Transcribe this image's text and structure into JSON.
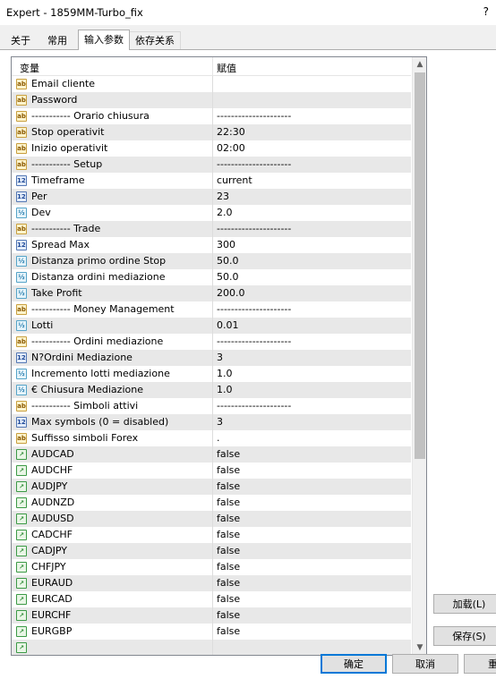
{
  "window": {
    "title": "Expert - 1859MM-Turbo_fix",
    "help": "?"
  },
  "tabs": [
    {
      "label": "关于"
    },
    {
      "label": "常用"
    },
    {
      "label": "输入参数"
    },
    {
      "label": "依存关系"
    }
  ],
  "columns": {
    "variable": "变量",
    "value": "赋值"
  },
  "rows": [
    {
      "icon": "ab",
      "name": "Email cliente",
      "value": ""
    },
    {
      "icon": "ab",
      "name": "Password",
      "value": ""
    },
    {
      "icon": "ab",
      "name": "----------- Orario chiusura",
      "value": "---------------------"
    },
    {
      "icon": "ab",
      "name": "Stop operativit",
      "value": "22:30"
    },
    {
      "icon": "ab",
      "name": "Inizio operativit",
      "value": "02:00"
    },
    {
      "icon": "ab",
      "name": "----------- Setup",
      "value": "---------------------"
    },
    {
      "icon": "123",
      "name": "Timeframe",
      "value": "current"
    },
    {
      "icon": "123",
      "name": "Per",
      "value": "23"
    },
    {
      "icon": "half",
      "name": "Dev",
      "value": "2.0"
    },
    {
      "icon": "ab",
      "name": "----------- Trade",
      "value": "---------------------"
    },
    {
      "icon": "123",
      "name": "Spread Max",
      "value": "300"
    },
    {
      "icon": "half",
      "name": "Distanza primo ordine Stop",
      "value": "50.0"
    },
    {
      "icon": "half",
      "name": "Distanza ordini mediazione",
      "value": "50.0"
    },
    {
      "icon": "half",
      "name": "Take Profit",
      "value": "200.0"
    },
    {
      "icon": "ab",
      "name": "----------- Money Management",
      "value": "---------------------"
    },
    {
      "icon": "half",
      "name": "Lotti",
      "value": "0.01"
    },
    {
      "icon": "ab",
      "name": "----------- Ordini mediazione",
      "value": "---------------------"
    },
    {
      "icon": "123",
      "name": "N?Ordini Mediazione",
      "value": "3"
    },
    {
      "icon": "half",
      "name": "Incremento lotti mediazione",
      "value": "1.0"
    },
    {
      "icon": "half",
      "name": "€ Chiusura Mediazione",
      "value": "1.0"
    },
    {
      "icon": "ab",
      "name": "----------- Simboli attivi",
      "value": "---------------------"
    },
    {
      "icon": "123",
      "name": "Max symbols (0 = disabled)",
      "value": "3"
    },
    {
      "icon": "ab",
      "name": "Suffisso simboli Forex",
      "value": "."
    },
    {
      "icon": "chart",
      "name": "AUDCAD",
      "value": "false"
    },
    {
      "icon": "chart",
      "name": "AUDCHF",
      "value": "false"
    },
    {
      "icon": "chart",
      "name": "AUDJPY",
      "value": "false"
    },
    {
      "icon": "chart",
      "name": "AUDNZD",
      "value": "false"
    },
    {
      "icon": "chart",
      "name": "AUDUSD",
      "value": "false"
    },
    {
      "icon": "chart",
      "name": "CADCHF",
      "value": "false"
    },
    {
      "icon": "chart",
      "name": "CADJPY",
      "value": "false"
    },
    {
      "icon": "chart",
      "name": "CHFJPY",
      "value": "false"
    },
    {
      "icon": "chart",
      "name": "EURAUD",
      "value": "false"
    },
    {
      "icon": "chart",
      "name": "EURCAD",
      "value": "false"
    },
    {
      "icon": "chart",
      "name": "EURCHF",
      "value": "false"
    },
    {
      "icon": "chart",
      "name": "EURGBP",
      "value": "false"
    },
    {
      "icon": "chart",
      "name": "",
      "value": ""
    }
  ],
  "buttons": {
    "load": "加载(L)",
    "save": "保存(S)",
    "ok": "确定",
    "cancel": "取消",
    "reset": "重"
  },
  "icons": {
    "ab": "ab",
    "123": "123",
    "half": "½",
    "chart": "↗"
  }
}
